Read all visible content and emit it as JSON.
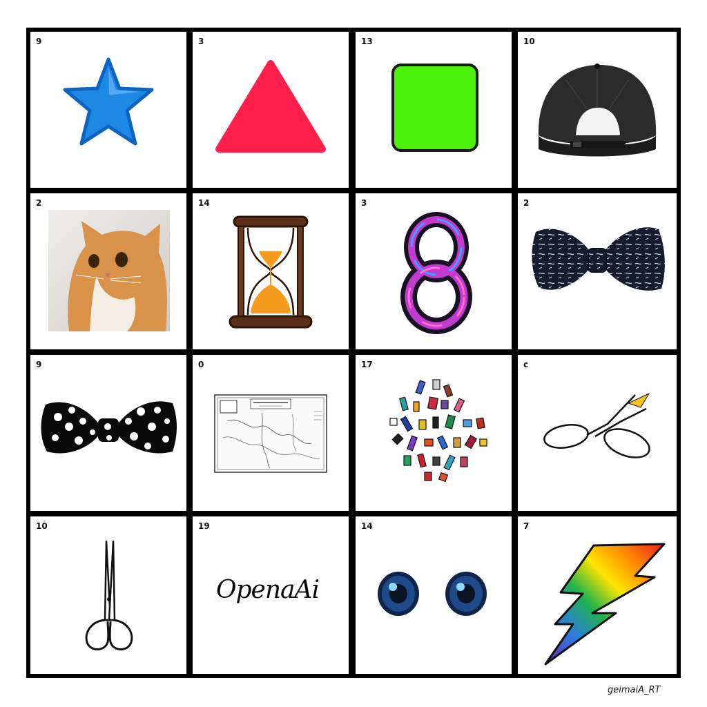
{
  "cells": [
    {
      "number": "9",
      "icon": "blue-star-icon"
    },
    {
      "number": "3",
      "icon": "red-triangle-icon"
    },
    {
      "number": "13",
      "icon": "green-square-icon"
    },
    {
      "number": "10",
      "icon": "baseball-cap-icon"
    },
    {
      "number": "2",
      "icon": "cat-photo"
    },
    {
      "number": "14",
      "icon": "hourglass-icon"
    },
    {
      "number": "3",
      "icon": "figure-eight-icon"
    },
    {
      "number": "2",
      "icon": "patterned-bow-tie-icon"
    },
    {
      "number": "9",
      "icon": "polka-dot-bow-tie-icon"
    },
    {
      "number": "0",
      "icon": "map-icon"
    },
    {
      "number": "17",
      "icon": "scattered-objects-icon"
    },
    {
      "number": "c",
      "icon": "open-scissors-icon"
    },
    {
      "number": "10",
      "icon": "scissors-icon"
    },
    {
      "number": "19",
      "icon": "handwritten-text",
      "text": "OpenaAi"
    },
    {
      "number": "14",
      "icon": "eyes-icon"
    },
    {
      "number": "7",
      "icon": "rainbow-lightning-icon"
    }
  ],
  "signature": "geimaiA_RT",
  "colors": {
    "grid_line": "#000000",
    "star": "#1e88e5",
    "triangle": "#ff1f4b",
    "square": "#4cf20c",
    "cap": "#2b2b2b",
    "hourglass_wood": "#5a2f16",
    "sand": "#f59a1c",
    "eye": "#1e4a8a"
  }
}
